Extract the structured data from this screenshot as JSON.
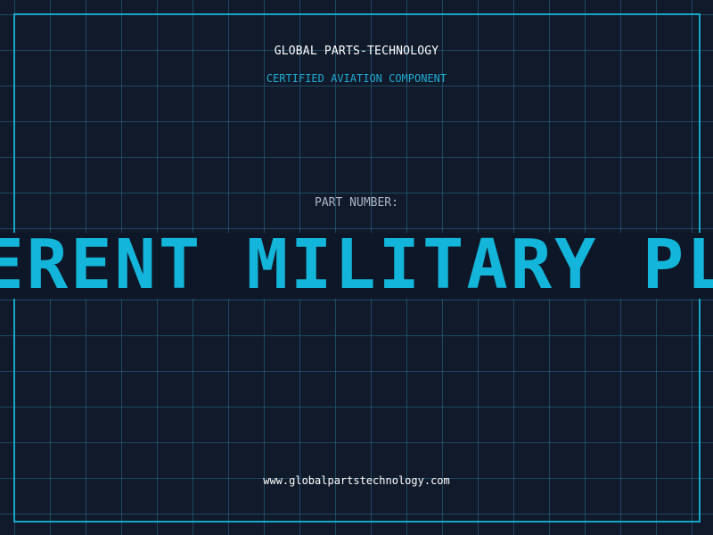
{
  "label": {
    "company": "GLOBAL PARTS-TECHNOLOGY",
    "certification": "CERTIFIED AVIATION COMPONENT",
    "part_number_label": "PART NUMBER:",
    "part_number_value": "DIFFERENT MILITARY PLANES",
    "website": "www.globalpartstechnology.com"
  },
  "colors": {
    "background": "#111a2b",
    "grid": "#286e8c",
    "frame": "#17a6c8",
    "accent": "#13b5da",
    "text": "#ffffff",
    "muted": "#a9b4c4"
  }
}
